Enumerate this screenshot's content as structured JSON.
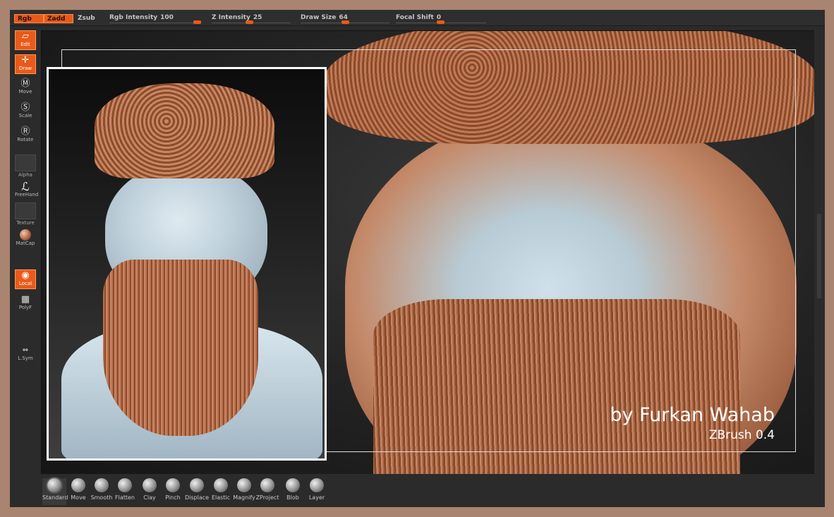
{
  "topbar": {
    "rgb": "Rgb",
    "zadd": "Zadd",
    "zsub": "Zsub",
    "rgb_intensity_label": "Rgb Intensity",
    "rgb_intensity_value": "100",
    "z_intensity_label": "Z Intensity",
    "z_intensity_value": "25",
    "draw_size_label": "Draw Size",
    "draw_size_value": "64",
    "focal_shift_label": "Focal Shift",
    "focal_shift_value": "0"
  },
  "lefttoolbar": {
    "edit": "Edit",
    "draw": "Draw",
    "move": "Move",
    "scale": "Scale",
    "rotate": "Rotate",
    "alpha": "Alpha",
    "freehand": "FreeHand",
    "texture": "Texture",
    "matcap": "MatCap",
    "local": "Local",
    "polyf": "PolyF",
    "lsym": "L.Sym"
  },
  "canvas": {
    "author": "by Furkan Wahab",
    "software": "ZBrush 0.4"
  },
  "brushes": [
    "Standard",
    "Move",
    "Smooth",
    "Flatten",
    "Clay",
    "Pinch",
    "Displace",
    "Elastic",
    "Magnify",
    "ZProject",
    "Blob",
    "Layer"
  ],
  "colors": {
    "accent": "#e95a1a",
    "frame": "#a98470",
    "ui_bg": "#2b2b2b"
  }
}
